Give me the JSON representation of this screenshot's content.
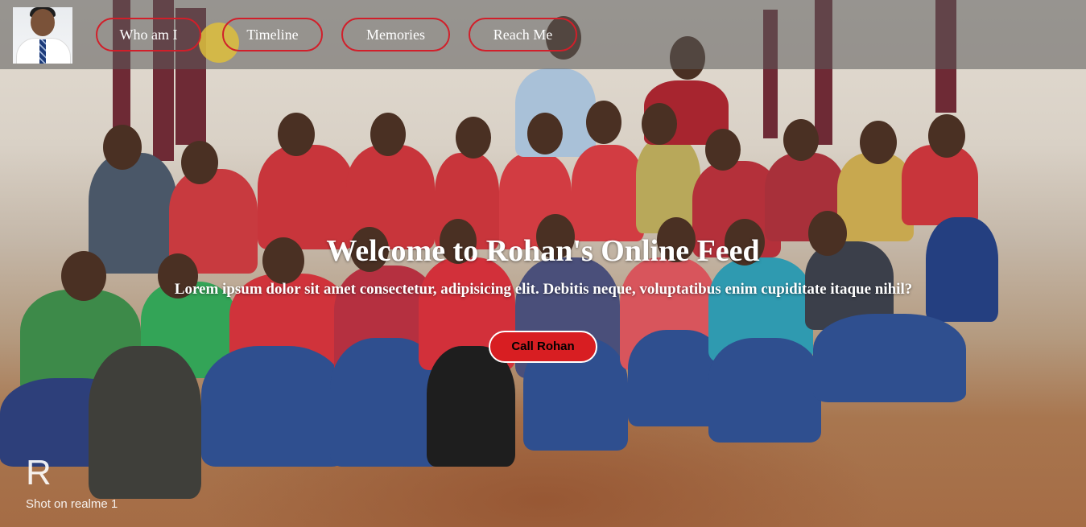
{
  "nav": {
    "items": [
      {
        "label": "Who am I"
      },
      {
        "label": "Timeline"
      },
      {
        "label": "Memories"
      },
      {
        "label": "Reach Me"
      }
    ],
    "accent_color": "#d11f2a"
  },
  "hero": {
    "title": "Welcome to Rohan's Online Feed",
    "subtitle": "Lorem ipsum dolor sit amet consectetur, adipisicing elit. Debitis neque, voluptatibus enim cupiditate itaque nihil?",
    "cta_label": "Call Rohan",
    "cta_color": "#d81e22"
  },
  "photo": {
    "watermark_logo": "R",
    "watermark_caption": "Shot on realme 1"
  }
}
